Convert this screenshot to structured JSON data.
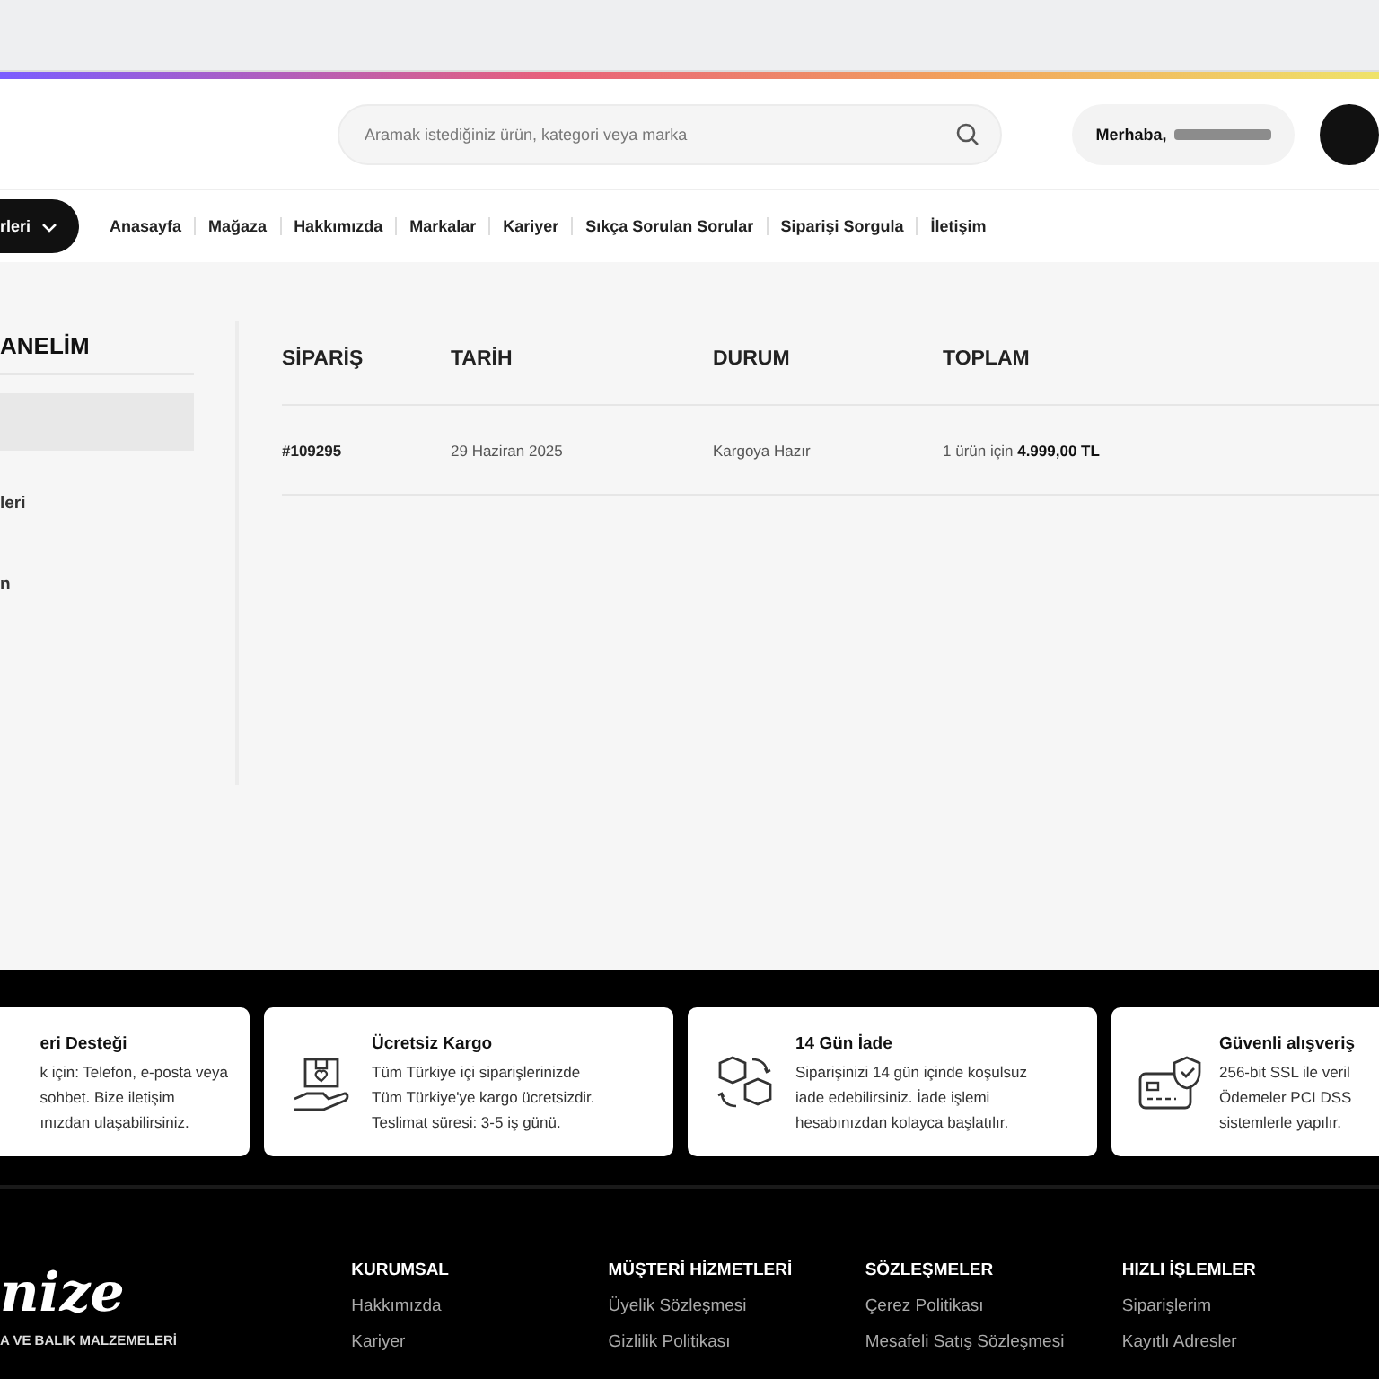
{
  "header": {
    "search": {
      "placeholder": "Aramak istediğiniz ürün, kategori veya marka"
    },
    "greeting": "Merhaba,"
  },
  "nav": {
    "category_button": "rleri",
    "links": [
      "Anasayfa",
      "Mağaza",
      "Hakkımızda",
      "Markalar",
      "Kariyer",
      "Sıkça Sorulan Sorular",
      "Siparişi Sorgula",
      "İletişim"
    ]
  },
  "sidebar": {
    "title": "ANELİM",
    "items": [
      {
        "selected": true
      },
      {
        "label": "leri",
        "selected": false
      },
      {
        "label": "n",
        "selected": false
      }
    ]
  },
  "table": {
    "columns": [
      "SİPARİŞ",
      "TARİH",
      "DURUM",
      "TOPLAM"
    ],
    "rows": [
      {
        "order": "#109295",
        "date": "29 Haziran 2025",
        "status": "Kargoya Hazır",
        "total": "1 ürün için **4.999,00 TL**"
      }
    ]
  },
  "features": [
    {
      "kind": "text_only",
      "title": "eri Desteği",
      "lines": [
        "k için: Telefon, e-posta veya",
        "sohbet. Bize iletişim",
        "ınızdan ulaşabilirsiniz."
      ]
    },
    {
      "kind": "shipping",
      "title": "Ücretsiz Kargo",
      "lines": [
        "Tüm Türkiye içi siparişlerinizde",
        "Tüm Türkiye'ye kargo ücretsizdir.",
        "Teslimat süresi: 3-5 iş günü."
      ]
    },
    {
      "kind": "return",
      "title": "14 Gün İade",
      "lines": [
        "Siparişinizi 14 gün içinde koşulsuz",
        "iade edebilirsiniz. İade işlemi",
        "hesabınızdan kolayca başlatılır."
      ]
    },
    {
      "kind": "secure",
      "title": "Güvenli alışveriş",
      "lines": [
        "256-bit SSL ile veril",
        "Ödemeler PCI DSS",
        "sistemlerle yapılır."
      ]
    }
  ],
  "footer": {
    "logo": "nize",
    "tagline": "A VE BALIK MALZEMELERİ",
    "columns": [
      {
        "title": "KURUMSAL",
        "links": [
          "Hakkımızda",
          "Kariyer"
        ]
      },
      {
        "title": "MÜŞTERİ HİZMETLERİ",
        "links": [
          "Üyelik Sözleşmesi",
          "Gizlilik Politikası"
        ]
      },
      {
        "title": "SÖZLEŞMELER",
        "links": [
          "Çerez Politikası",
          "Mesafeli Satış Sözleşmesi"
        ]
      },
      {
        "title": "HIZLI İŞLEMLER",
        "links": [
          "Siparişlerim",
          "Kayıtlı Adresler"
        ]
      }
    ]
  }
}
